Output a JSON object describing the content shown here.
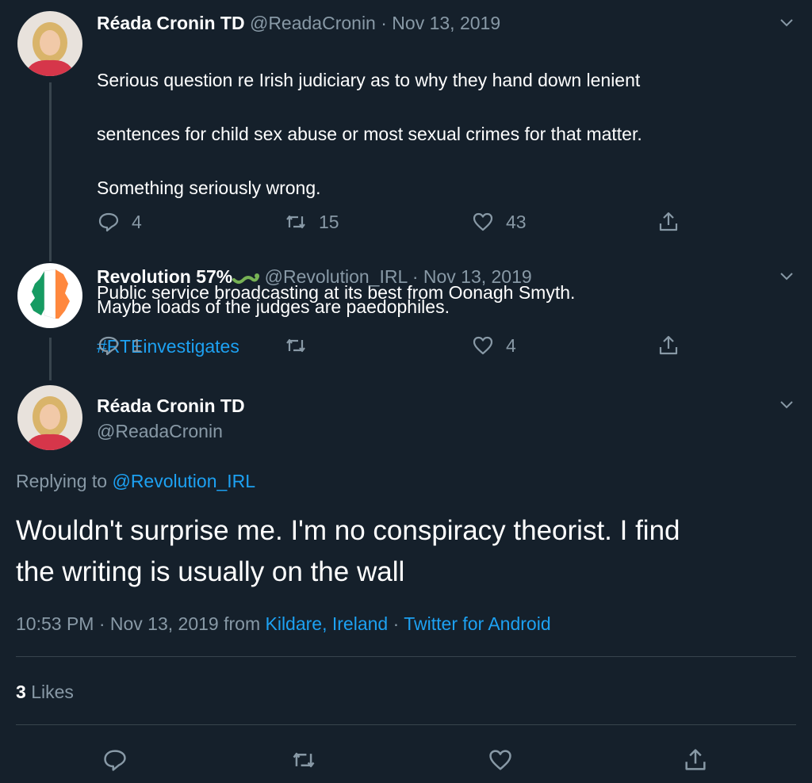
{
  "tweet1": {
    "name": "Réada Cronin TD",
    "handle": "@ReadaCronin",
    "date": "· Nov 13, 2019",
    "text_line1": "Serious question re Irish judiciary as to why they hand down lenient",
    "text_line2": "sentences for child sex abuse or most sexual crimes for that matter.",
    "text_line3": "Something seriously wrong.",
    "text_line4": "Public service broadcasting at its best from Oonagh Smyth.",
    "hashtag": "#RTEinvestigates",
    "replies": "4",
    "retweets": "15",
    "likes": "43"
  },
  "tweet2": {
    "name": "Revolution 57%",
    "handle": "@Revolution_IRL",
    "date": "· Nov 13, 2019",
    "text": "Maybe loads of the judges are paedophiles.",
    "replies": "1",
    "retweets": "",
    "likes": "4"
  },
  "main": {
    "name": "Réada Cronin TD",
    "handle": "@ReadaCronin",
    "replying_prefix": "Replying to",
    "replying_to": "@Revolution_IRL",
    "text_line1": "Wouldn't surprise me. I'm no conspiracy theorist. I find",
    "text_line2": "the writing is usually on the wall",
    "time": "10:53 PM · Nov 13, 2019 from",
    "location": "Kildare, Ireland",
    "sep": "·",
    "source": "Twitter for Android",
    "likes_count": "3",
    "likes_label": "Likes"
  },
  "colors": {
    "background": "#15202b",
    "muted": "#8899a6",
    "link": "#1da1f2",
    "divider": "#38444d"
  },
  "icons": [
    "reply-icon",
    "retweet-icon",
    "like-icon",
    "share-icon",
    "chevron-down-icon",
    "snake-emoji-icon"
  ]
}
